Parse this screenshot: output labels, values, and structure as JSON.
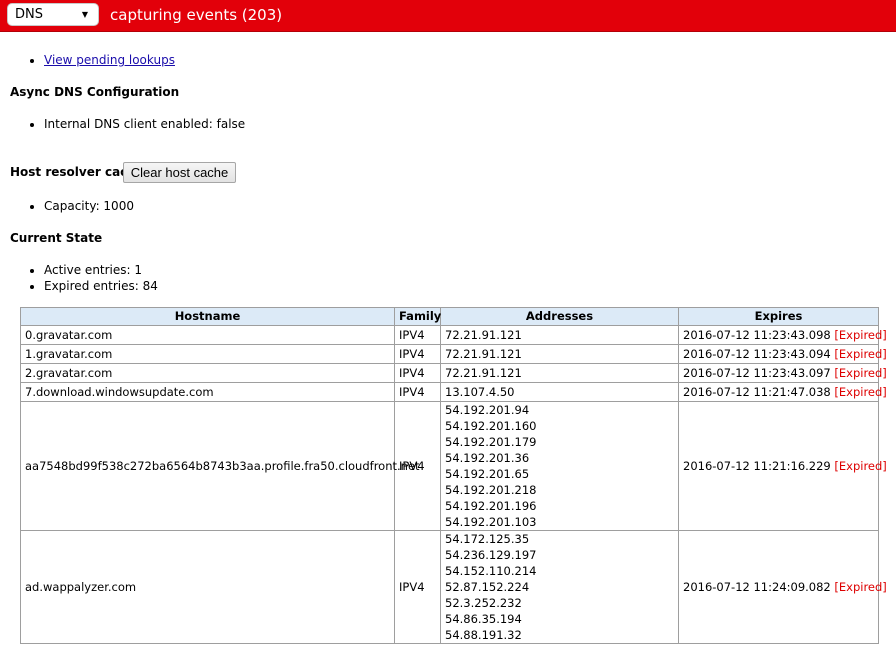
{
  "toolbar": {
    "selected_view": "DNS",
    "status": "capturing events (203)"
  },
  "links": {
    "pending_lookups": "View pending lookups"
  },
  "async_config": {
    "heading": "Async DNS Configuration",
    "items": [
      "Internal DNS client enabled: false"
    ]
  },
  "host_cache": {
    "heading": "Host resolver cache",
    "button": "Clear host cache",
    "items": [
      "Capacity: 1000"
    ]
  },
  "current_state": {
    "heading": "Current State",
    "items": [
      "Active entries: 1",
      "Expired entries: 84"
    ]
  },
  "table": {
    "headers": [
      "Hostname",
      "Family",
      "Addresses",
      "Expires"
    ],
    "expired_label": "[Expired]",
    "rows": [
      {
        "hostname": "0.gravatar.com",
        "family": "IPV4",
        "addresses": [
          "72.21.91.121"
        ],
        "expires": "2016-07-12 11:23:43.098"
      },
      {
        "hostname": "1.gravatar.com",
        "family": "IPV4",
        "addresses": [
          "72.21.91.121"
        ],
        "expires": "2016-07-12 11:23:43.094"
      },
      {
        "hostname": "2.gravatar.com",
        "family": "IPV4",
        "addresses": [
          "72.21.91.121"
        ],
        "expires": "2016-07-12 11:23:43.097"
      },
      {
        "hostname": "7.download.windowsupdate.com",
        "family": "IPV4",
        "addresses": [
          "13.107.4.50"
        ],
        "expires": "2016-07-12 11:21:47.038"
      },
      {
        "hostname": "aa7548bd99f538c272ba6564b8743b3aa.profile.fra50.cloudfront.net",
        "family": "IPV4",
        "addresses": [
          "54.192.201.94",
          "54.192.201.160",
          "54.192.201.179",
          "54.192.201.36",
          "54.192.201.65",
          "54.192.201.218",
          "54.192.201.196",
          "54.192.201.103"
        ],
        "expires": "2016-07-12 11:21:16.229"
      },
      {
        "hostname": "ad.wappalyzer.com",
        "family": "IPV4",
        "addresses": [
          "54.172.125.35",
          "54.236.129.197",
          "54.152.110.214",
          "52.87.152.224",
          "52.3.252.232",
          "54.86.35.194",
          "54.88.191.32"
        ],
        "expires": "2016-07-12 11:24:09.082"
      }
    ]
  }
}
